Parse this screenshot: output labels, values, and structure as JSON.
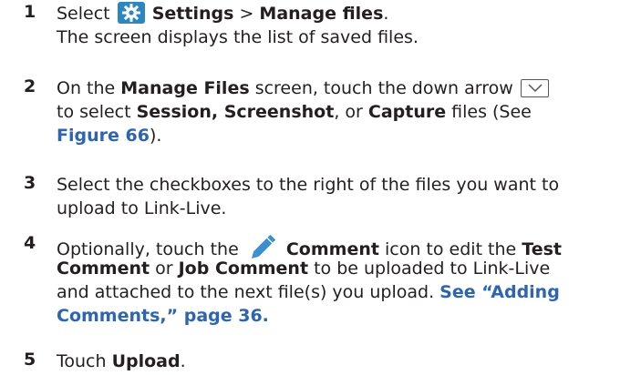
{
  "steps": [
    {
      "num": "1",
      "t_select": "Select",
      "t_settings": "Settings",
      "t_gt": " > ",
      "t_manage": "Manage files",
      "t_period": ".",
      "t_line2": "The screen displays the list of saved files.",
      "icon": "gear-icon"
    },
    {
      "num": "2",
      "t_on": "On the ",
      "t_manage_files": "Manage Files",
      "t_touch": " screen, touch the down arrow",
      "t_to_select": "to select ",
      "t_session": "Session, Screenshot",
      "t_or": ", or ",
      "t_capture": "Capture",
      "t_files": " files (See",
      "t_figure": "Figure 66",
      "t_close": ").",
      "icon": "chevron-down-icon"
    },
    {
      "num": "3",
      "t_line1": "Select the checkboxes to the right of the files you want to",
      "t_line2": "upload to Link-Live."
    },
    {
      "num": "4",
      "t_opt": "Optionally, touch the",
      "t_comment": "Comment",
      "t_icon_to": " icon to edit the ",
      "t_test": "Test",
      "t_comment2": "Comment",
      "t_or": " or ",
      "t_job": "Job Comment",
      "t_uploaded": " to be uploaded to Link-Live",
      "t_line3a": "and attached to the next file(s) you upload. ",
      "t_see": "See “Adding",
      "t_line4": "Comments,” page 36.",
      "icon": "pencil-icon"
    },
    {
      "num": "5",
      "t_touch": "Touch ",
      "t_upload": "Upload",
      "t_period": "."
    }
  ],
  "colors": {
    "text": "#231f20",
    "link": "#2e64b0",
    "gear_bg": "#2e86c1",
    "pencil": "#3a8fd0"
  }
}
